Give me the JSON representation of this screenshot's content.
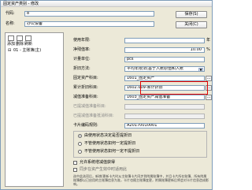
{
  "window": {
    "title": "固定资产类别 - 修改"
  },
  "header": {
    "code_label": "代码:",
    "code_value": "8",
    "name_label": "名称:",
    "name_value": "办公设备",
    "save_label": "保存(S)",
    "close_label": "关闭(C)"
  },
  "tree": {
    "toolbar": [
      {
        "label": "添加",
        "icon": "add-icon"
      },
      {
        "label": "删除",
        "icon": "delete-icon"
      },
      {
        "label": "刷新",
        "icon": "refresh-icon"
      }
    ],
    "item_label": "01 - 主账簿(主)",
    "expand_glyph": "⊟"
  },
  "form": {
    "fields": [
      {
        "label": "使用年限:",
        "value": "",
        "unit": "年"
      },
      {
        "label": "净残值率:",
        "value": "10.00",
        "unit": "%"
      },
      {
        "label": "计量单位:",
        "value": "pcs"
      },
      {
        "label": "折旧方法:",
        "value": "平均年限法(基于入账原值和入账"
      },
      {
        "label": "固定资产科目:",
        "value": "1601_固定资产"
      },
      {
        "label": "累计折旧科目:",
        "value": "1602.009-累计折旧"
      },
      {
        "label": "减值准备科目:",
        "value": "1603_固定资产减值准备"
      },
      {
        "label": "已提减值准备科目:",
        "value": ""
      },
      {
        "label": "已提减值准备抵消科目:",
        "value": ""
      },
      {
        "label": "卡片编码规则:",
        "value": "A20170010001"
      }
    ]
  },
  "depreciation_options": {
    "options": [
      "由使用状态决定是否提折旧",
      "不管使用状态如何一定提折旧",
      "不管使用状态如何一定不提折旧"
    ],
    "selected_index": 0
  },
  "checkboxes": [
    {
      "label": "允许系统增减值获得",
      "checked": false
    },
    {
      "label": "同步在资产生效中时适用此",
      "checked": false
    }
  ],
  "note": "选中此选项后，新增/更新卡片时从主账簿卡片同步到附属账簿中，并且卡片所在账簿、所有附属账簿都以已启用的主账簿信息为准，卡片也随主账簿变更，附属账簿更新后将会对卡片信息造成影响。",
  "colors": {
    "highlight": "#e00000",
    "window_bg": "#ece9d8",
    "input_border": "#7f9db9"
  }
}
